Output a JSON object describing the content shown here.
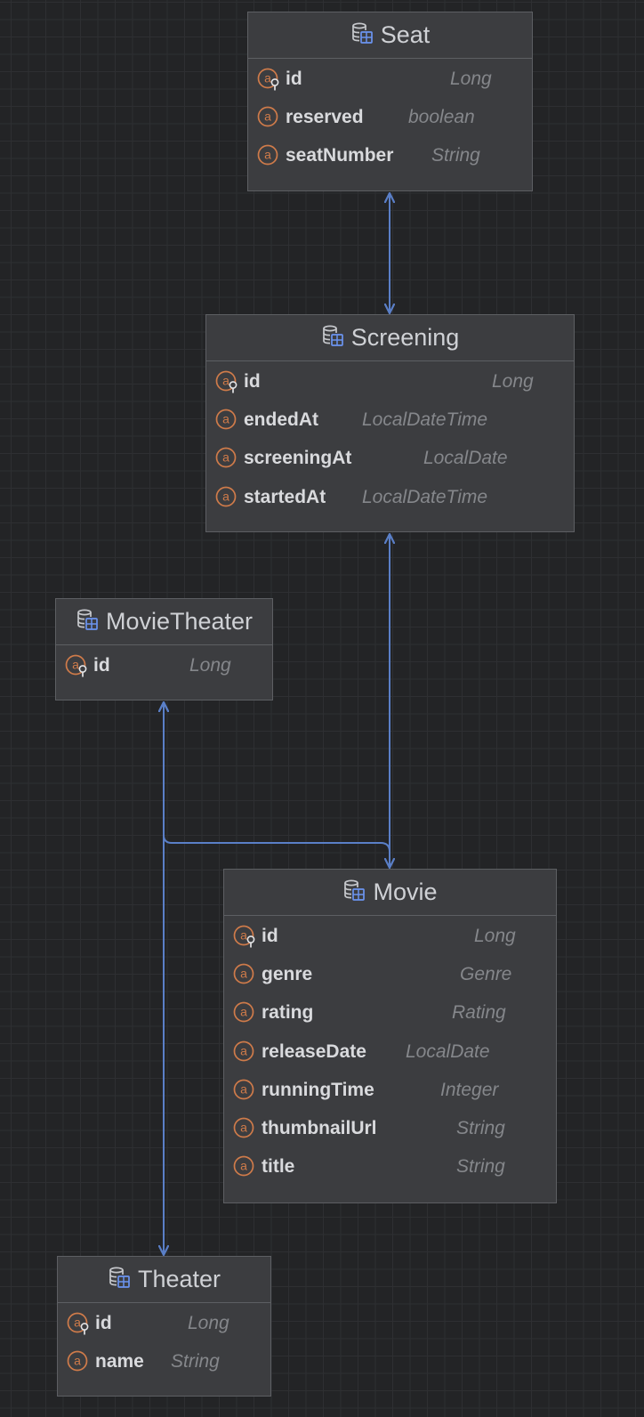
{
  "colors": {
    "canvas": "#232426",
    "grid": "#34363a",
    "entity_fill": "#3c3d40",
    "entity_border": "#5d5f63",
    "connector": "#5a7fc7",
    "attribute_icon": "#cf7b4a",
    "entity_icon_accent": "#6b94f0"
  },
  "icons": {
    "entity": "database-table-icon",
    "attribute": "attribute-icon",
    "primary_key": "primary-key-icon"
  },
  "entities": {
    "seat": {
      "title": "Seat",
      "fields": [
        {
          "name": "id",
          "type": "Long",
          "primary_key": true
        },
        {
          "name": "reserved",
          "type": "boolean",
          "primary_key": false
        },
        {
          "name": "seatNumber",
          "type": "String",
          "primary_key": false
        }
      ]
    },
    "screening": {
      "title": "Screening",
      "fields": [
        {
          "name": "id",
          "type": "Long",
          "primary_key": true
        },
        {
          "name": "endedAt",
          "type": "LocalDateTime",
          "primary_key": false
        },
        {
          "name": "screeningAt",
          "type": "LocalDate",
          "primary_key": false
        },
        {
          "name": "startedAt",
          "type": "LocalDateTime",
          "primary_key": false
        }
      ]
    },
    "movie_theater": {
      "title": "MovieTheater",
      "fields": [
        {
          "name": "id",
          "type": "Long",
          "primary_key": true
        }
      ]
    },
    "movie": {
      "title": "Movie",
      "fields": [
        {
          "name": "id",
          "type": "Long",
          "primary_key": true
        },
        {
          "name": "genre",
          "type": "Genre",
          "primary_key": false
        },
        {
          "name": "rating",
          "type": "Rating",
          "primary_key": false
        },
        {
          "name": "releaseDate",
          "type": "LocalDate",
          "primary_key": false
        },
        {
          "name": "runningTime",
          "type": "Integer",
          "primary_key": false
        },
        {
          "name": "thumbnailUrl",
          "type": "String",
          "primary_key": false
        },
        {
          "name": "title",
          "type": "String",
          "primary_key": false
        }
      ]
    },
    "theater": {
      "title": "Theater",
      "fields": [
        {
          "name": "id",
          "type": "Long",
          "primary_key": true
        },
        {
          "name": "name",
          "type": "String",
          "primary_key": false
        }
      ]
    }
  },
  "relationships": [
    {
      "from": "Seat",
      "to": "Screening",
      "arrows": "both"
    },
    {
      "from": "Screening",
      "to": "Movie",
      "arrows": "both"
    },
    {
      "from": "MovieTheater",
      "to": "Movie",
      "arrows": "from"
    },
    {
      "from": "MovieTheater",
      "to": "Theater",
      "arrows": "both"
    }
  ]
}
